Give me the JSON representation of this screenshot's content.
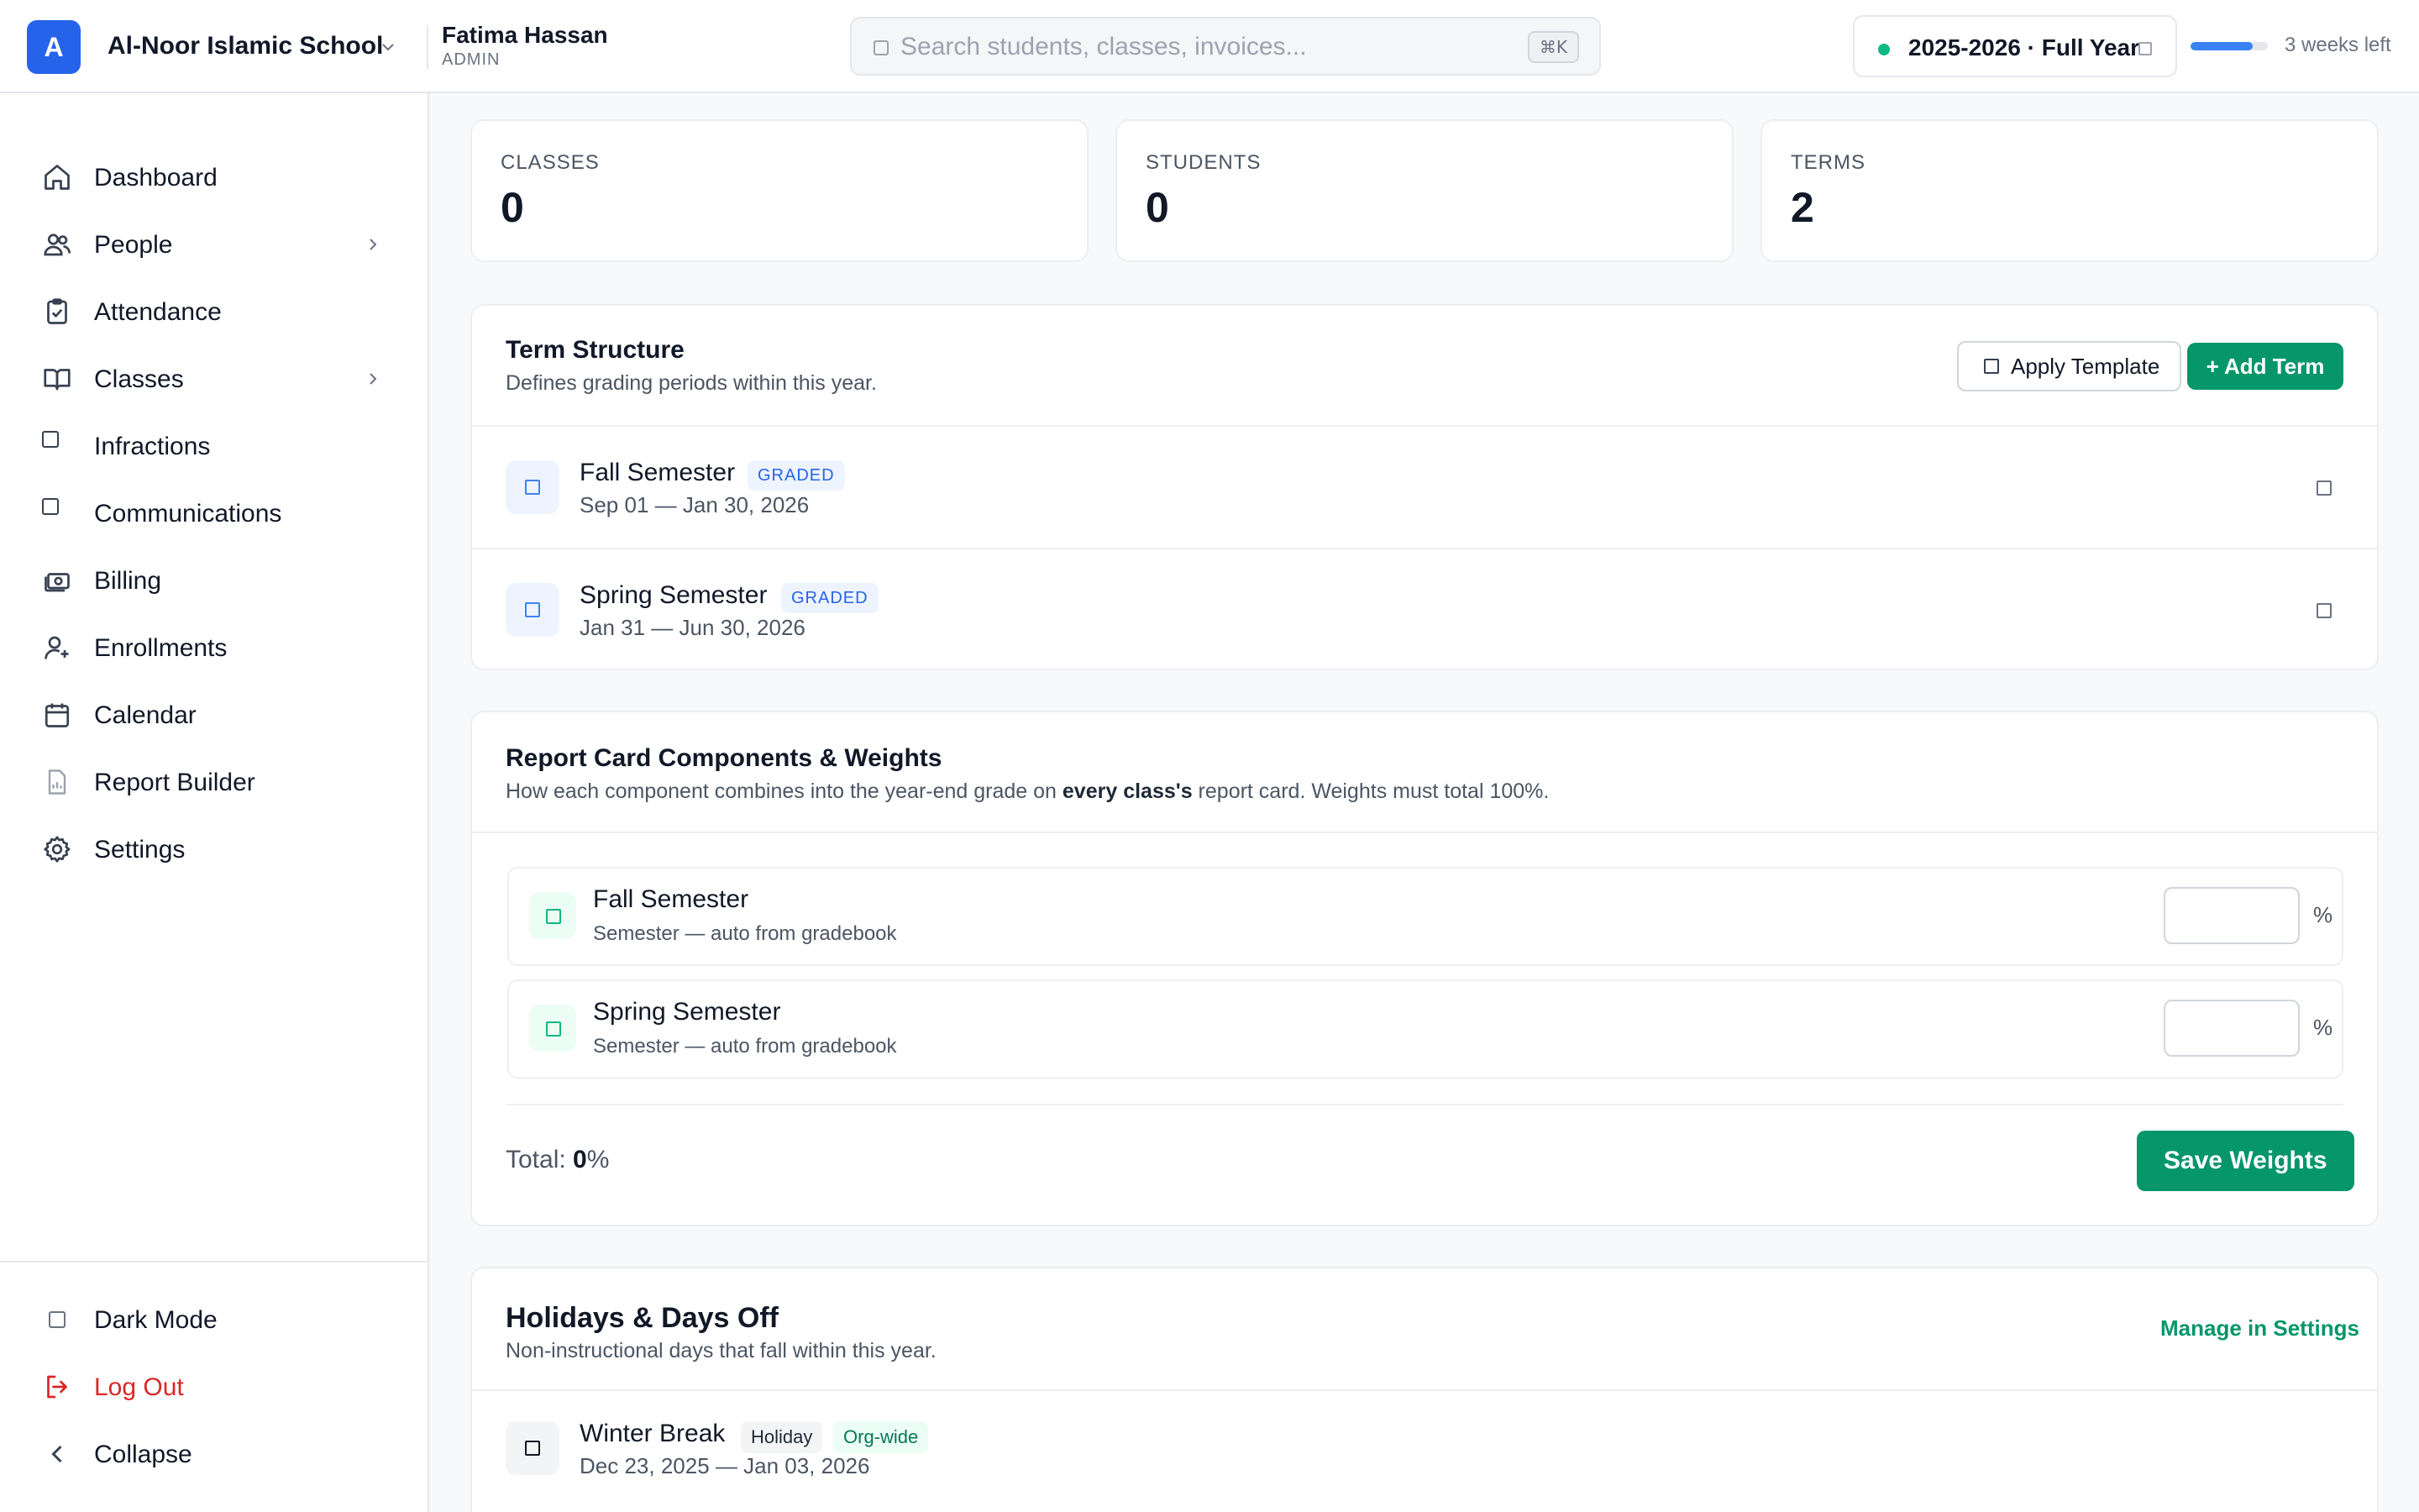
{
  "header": {
    "logo_letter": "A",
    "school_name": "Al-Noor Islamic School",
    "user_name": "Fatima Hassan",
    "user_role": "ADMIN",
    "search_placeholder": "Search students, classes, invoices...",
    "search_shortcut": "⌘K",
    "academic_year": "2025-2026 · Full Year",
    "year_status_color": "#10b981",
    "year_progress_percent": 80,
    "time_left": "3 weeks left"
  },
  "sidebar": {
    "items": [
      {
        "label": "Dashboard",
        "icon": "home-icon"
      },
      {
        "label": "People",
        "icon": "users-icon",
        "has_children": true
      },
      {
        "label": "Attendance",
        "icon": "clipboard-check-icon"
      },
      {
        "label": "Classes",
        "icon": "book-icon",
        "has_children": true
      },
      {
        "label": "Infractions",
        "icon": "square-icon"
      },
      {
        "label": "Communications",
        "icon": "square-icon"
      },
      {
        "label": "Billing",
        "icon": "money-icon"
      },
      {
        "label": "Enrollments",
        "icon": "user-plus-icon"
      },
      {
        "label": "Calendar",
        "icon": "calendar-icon"
      },
      {
        "label": "Report Builder",
        "icon": "report-icon"
      },
      {
        "label": "Settings",
        "icon": "gear-icon"
      }
    ],
    "footer": {
      "dark_mode": "Dark Mode",
      "logout": "Log Out",
      "collapse": "Collapse"
    }
  },
  "stats": [
    {
      "label": "CLASSES",
      "value": "0"
    },
    {
      "label": "STUDENTS",
      "value": "0"
    },
    {
      "label": "TERMS",
      "value": "2"
    }
  ],
  "term_structure": {
    "title": "Term Structure",
    "subtitle": "Defines grading periods within this year.",
    "apply_template_label": "Apply Template",
    "add_term_label": "+ Add Term",
    "terms": [
      {
        "name": "Fall Semester",
        "badge": "GRADED",
        "dates": "Sep 01 — Jan 30, 2026"
      },
      {
        "name": "Spring Semester",
        "badge": "GRADED",
        "dates": "Jan 31 — Jun 30, 2026"
      }
    ]
  },
  "report_card": {
    "title": "Report Card Components & Weights",
    "subtitle_pre": "How each component combines into the year-end grade on ",
    "subtitle_bold": "every class's",
    "subtitle_post": " report card. Weights must total 100%.",
    "components": [
      {
        "name": "Fall Semester",
        "source": "Semester — auto from gradebook",
        "weight": "",
        "unit": "%"
      },
      {
        "name": "Spring Semester",
        "source": "Semester — auto from gradebook",
        "weight": "",
        "unit": "%"
      }
    ],
    "total_label": "Total: ",
    "total_value": "0",
    "total_unit": "%",
    "save_label": "Save Weights"
  },
  "holidays": {
    "title": "Holidays & Days Off",
    "subtitle": "Non-instructional days that fall within this year.",
    "manage_label": "Manage in Settings",
    "items": [
      {
        "name": "Winter Break",
        "type": "Holiday",
        "scope": "Org-wide",
        "dates": "Dec 23, 2025 — Jan 03, 2026"
      }
    ]
  },
  "colors": {
    "brand_blue": "#2563eb",
    "primary_green": "#059669",
    "danger_red": "#dc2626"
  }
}
